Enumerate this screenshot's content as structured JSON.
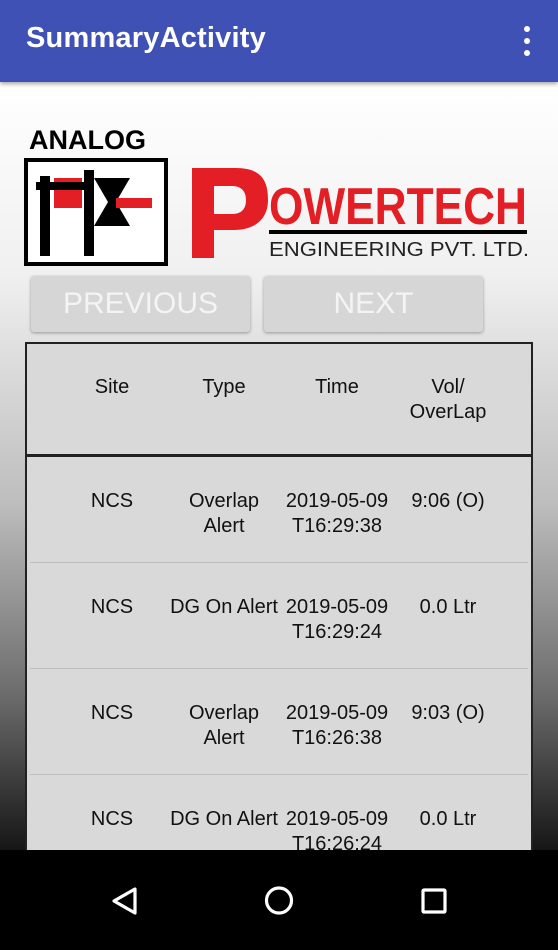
{
  "appbar": {
    "title": "SummaryActivity",
    "overflow_icon": "more-vert-icon",
    "color": "#3f51b5"
  },
  "logo": {
    "line1": "ANALOG",
    "brand_letter": "P",
    "brand_rest": "OWERTECH",
    "tagline": "ENGINEERING PVT. LTD.",
    "brand_color": "#e31e24"
  },
  "buttons": {
    "previous": "PREVIOUS",
    "next": "NEXT"
  },
  "table": {
    "headers": {
      "site": "Site",
      "type": "Type",
      "time": "Time",
      "vol_line1": "Vol/",
      "vol_line2": "OverLap"
    },
    "rows": [
      {
        "site": "NCS",
        "type_line1": "Overlap",
        "type_line2": "Alert",
        "time_line1": "2019-05-09",
        "time_line2": "T16:29:38",
        "vol": "9:06 (O)"
      },
      {
        "site": "NCS",
        "type_line1": "DG On Alert",
        "type_line2": "",
        "time_line1": "2019-05-09",
        "time_line2": "T16:29:24",
        "vol": "0.0 Ltr"
      },
      {
        "site": "NCS",
        "type_line1": "Overlap",
        "type_line2": "Alert",
        "time_line1": "2019-05-09",
        "time_line2": "T16:26:38",
        "vol": "9:03 (O)"
      },
      {
        "site": "NCS",
        "type_line1": "DG On Alert",
        "type_line2": "",
        "time_line1": "2019-05-09",
        "time_line2": "T16:26:24",
        "vol": "0.0 Ltr"
      }
    ]
  },
  "navbar": {
    "back_icon": "back-triangle-icon",
    "home_icon": "home-circle-icon",
    "recents_icon": "recents-square-icon"
  }
}
